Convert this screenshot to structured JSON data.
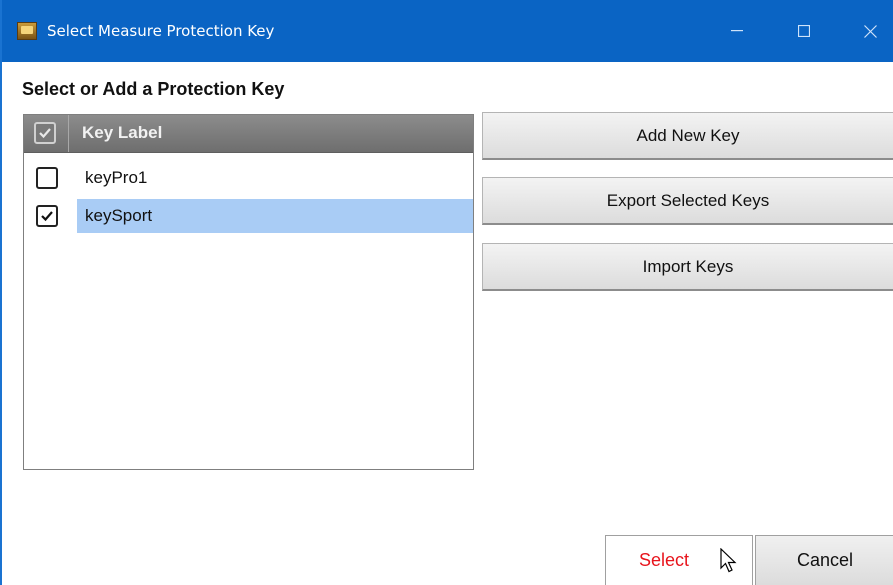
{
  "window": {
    "title": "Select Measure Protection Key",
    "icon": "app-icon",
    "controls": [
      "minimize-icon",
      "maximize-icon",
      "close-icon"
    ],
    "titlebar_color": "#0a64c4"
  },
  "section_title": "Select or Add a Protection Key",
  "list": {
    "header": {
      "label": "Key Label",
      "select_all_checked": true
    },
    "rows": [
      {
        "label": "keyPro1",
        "checked": false,
        "selected": false
      },
      {
        "label": "keySport",
        "checked": true,
        "selected": true
      }
    ],
    "selection_color": "#a9ccf5"
  },
  "actions": {
    "add_new_key": "Add New Key",
    "export_selected_keys": "Export Selected Keys",
    "import_keys": "Import Keys"
  },
  "footer": {
    "select_label": "Select",
    "select_color": "#e8141c",
    "cancel_label": "Cancel"
  }
}
